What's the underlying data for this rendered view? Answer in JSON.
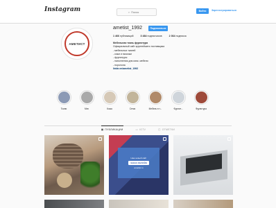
{
  "header": {
    "logo": "Instagram",
    "search_placeholder": "Поиск",
    "login_label": "Войти",
    "signup_label": "Зарегистрироваться"
  },
  "profile": {
    "avatar_text": "АМЕТИСТ",
    "username": "ametist_1992",
    "follow_label": "Подписаться",
    "stats": [
      {
        "value": "1 466",
        "label": "публикаций"
      },
      {
        "value": "3 484",
        "label": "подписчиков"
      },
      {
        "value": "2 364",
        "label": "подписок"
      }
    ],
    "bio_name": "Мебельная ткань фурнитура",
    "bio_lines": [
      "Официальный сайт крупнейшего поставщика",
      "- мебельных тканей",
      "- кожи и экокожи",
      "- фурнитуры",
      "- наполнения для мягк. мебели",
      "- поролона"
    ],
    "bio_link": "linktr.ee/ametist_1992"
  },
  "highlights": [
    {
      "label": "Ткани",
      "color": "#8c9ab5"
    },
    {
      "label": "Мех",
      "color": "#a9a9a9"
    },
    {
      "label": "Кожа",
      "color": "#d6c9b7"
    },
    {
      "label": "Сетки",
      "color": "#c2b59b"
    },
    {
      "label": "Мебель в т...",
      "color": "#b08a6a"
    },
    {
      "label": "Фурнит...",
      "color": "#cfd5db"
    },
    {
      "label": "Фурнитура",
      "color": "#9e4a3a"
    }
  ],
  "tabs": [
    {
      "label": "ПУБЛИКАЦИИ",
      "active": true
    },
    {
      "label": "IGTV",
      "active": false
    },
    {
      "label": "ОТМЕТКИ",
      "active": false
    }
  ],
  "posts": {
    "promo_line1": "Наш новый сайт",
    "promo_line2": "ЗАКАЗ ОНЛАЙН",
    "promo_line3": "ametist.ru"
  }
}
